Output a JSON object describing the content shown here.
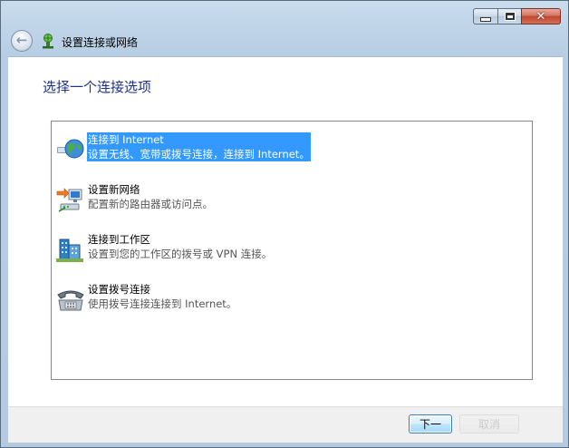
{
  "window": {
    "title": "设置连接或网络",
    "caption_buttons": [
      "minimize",
      "maximize",
      "close"
    ],
    "close_glyph": "✕",
    "back_arrow": "←"
  },
  "main": {
    "heading": "选择一个连接选项",
    "options": [
      {
        "title": "连接到 Internet",
        "description": "设置无线、宽带或拨号连接，连接到 Internet。",
        "icon": "globe-network-icon",
        "selected": true
      },
      {
        "title": "设置新网络",
        "description": "配置新的路由器或访问点。",
        "icon": "new-network-icon",
        "selected": false
      },
      {
        "title": "连接到工作区",
        "description": "设置到您的工作区的拨号或 VPN 连接。",
        "icon": "workplace-icon",
        "selected": false
      },
      {
        "title": "设置拨号连接",
        "description": "使用拨号连接连接到 Internet。",
        "icon": "dialup-phone-icon",
        "selected": false
      }
    ]
  },
  "footer": {
    "next_label": "下一",
    "cancel_label": "取消"
  },
  "colors": {
    "selection": "#3399ff",
    "heading": "#1e3287",
    "chrome": "#b7cde3"
  }
}
